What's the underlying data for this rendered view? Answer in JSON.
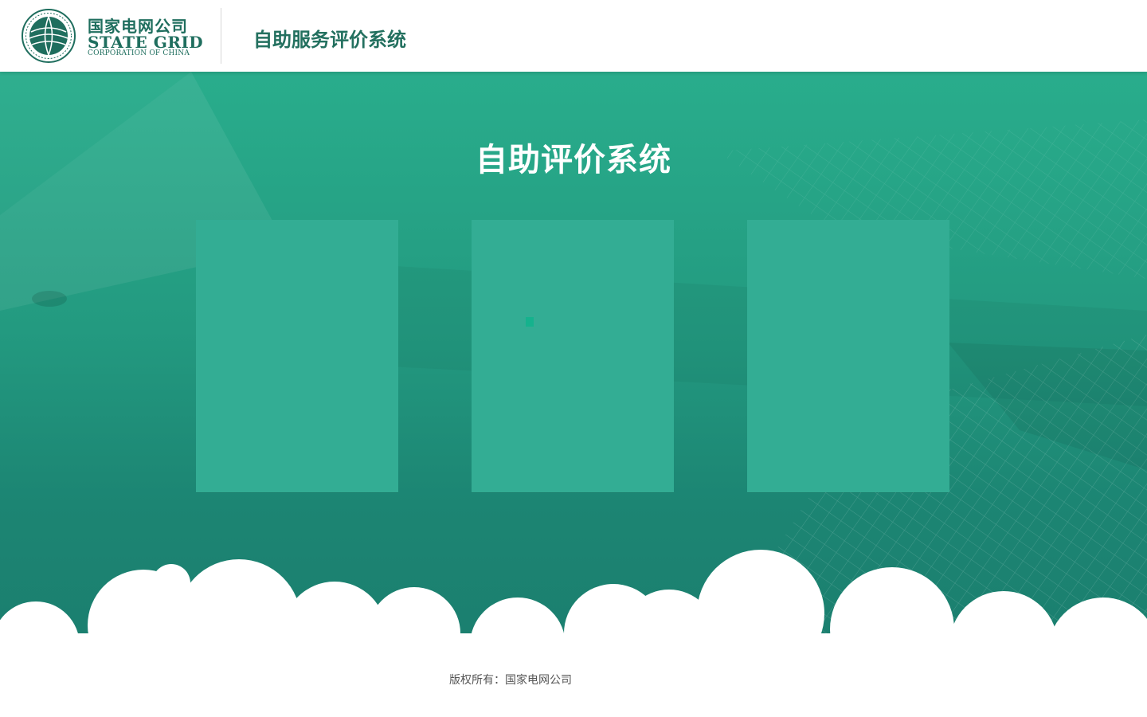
{
  "header": {
    "logo_cn": "国家电网公司",
    "logo_en": "STATE GRID",
    "logo_sub": "CORPORATION OF CHINA",
    "title": "自助服务评价系统"
  },
  "main": {
    "title": "自助评价系统",
    "cards": [
      {
        "label": ""
      },
      {
        "label": ""
      },
      {
        "label": ""
      }
    ]
  },
  "footer": {
    "copyright": "版权所有：国家电网公司"
  },
  "colors": {
    "brand_green": "#1f6e5e",
    "background_top": "#29ad8c",
    "background_bottom": "#1b7f6f",
    "card": "#33ad94"
  }
}
